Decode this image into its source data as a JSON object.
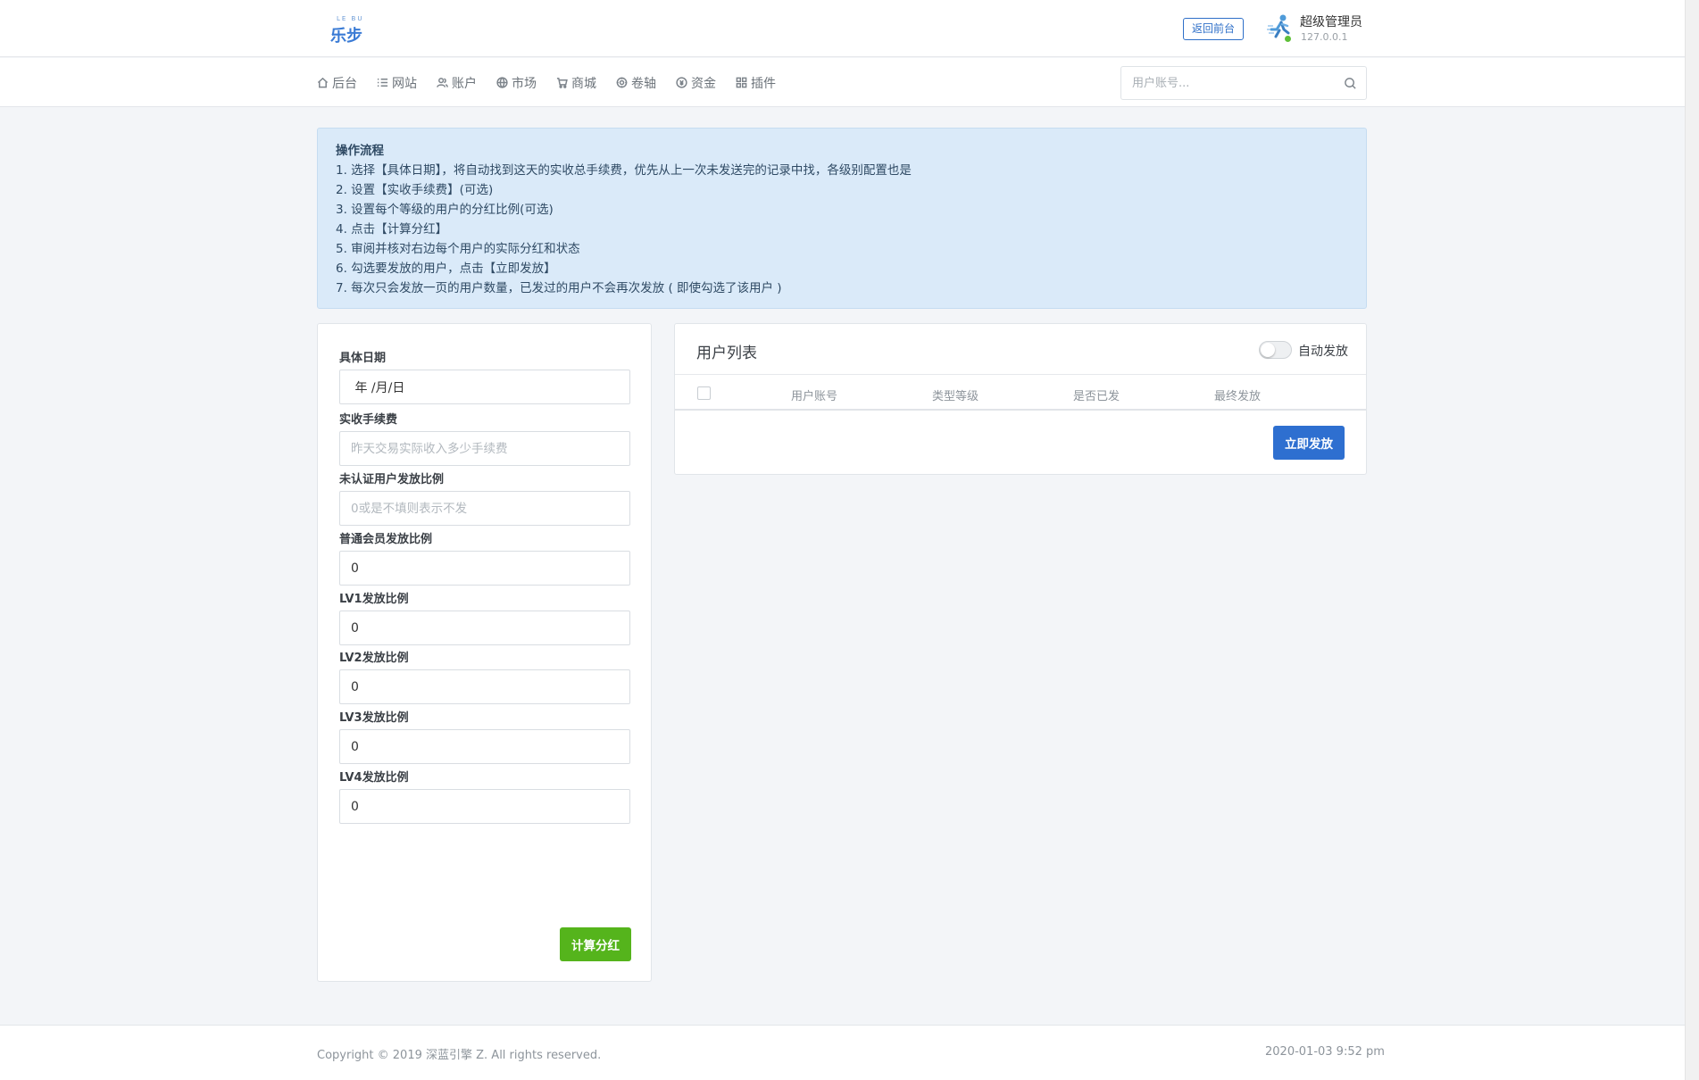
{
  "header": {
    "logo_top": "LE BU",
    "logo_text": "乐步",
    "back_label": "返回前台",
    "user_name": "超级管理员",
    "user_ip": "127.0.0.1"
  },
  "nav": {
    "items": [
      {
        "label": "后台",
        "icon": "home-icon"
      },
      {
        "label": "网站",
        "icon": "list-icon"
      },
      {
        "label": "账户",
        "icon": "users-icon"
      },
      {
        "label": "市场",
        "icon": "globe-icon"
      },
      {
        "label": "商城",
        "icon": "cart-icon"
      },
      {
        "label": "卷轴",
        "icon": "gear-icon"
      },
      {
        "label": "资金",
        "icon": "coin-icon"
      },
      {
        "label": "插件",
        "icon": "grid-icon"
      }
    ],
    "search_placeholder": "用户账号..."
  },
  "alert": {
    "title": "操作流程",
    "lines": [
      "1. 选择【具体日期】，将自动找到这天的实收总手续费，优先从上一次未发送完的记录中找，各级别配置也是",
      "2. 设置【实收手续费】(可选)",
      "3. 设置每个等级的用户的分红比例(可选)",
      "4. 点击【计算分红】",
      "5. 审阅并核对右边每个用户的实际分红和状态",
      "6. 勾选要发放的用户，点击【立即发放】",
      "7. 每次只会发放一页的用户数量，已发过的用户不会再次发放 ( 即使勾选了该用户 )"
    ]
  },
  "form": {
    "fields": [
      {
        "label": "具体日期",
        "value": " 年 /月/日",
        "placeholder": ""
      },
      {
        "label": "实收手续费",
        "value": "",
        "placeholder": "昨天交易实际收入多少手续费"
      },
      {
        "label": "未认证用户发放比例",
        "value": "",
        "placeholder": "0或是不填则表示不发"
      },
      {
        "label": "普通会员发放比例",
        "value": "0",
        "placeholder": ""
      },
      {
        "label": "LV1发放比例",
        "value": "0",
        "placeholder": ""
      },
      {
        "label": "LV2发放比例",
        "value": "0",
        "placeholder": ""
      },
      {
        "label": "LV3发放比例",
        "value": "0",
        "placeholder": ""
      },
      {
        "label": "LV4发放比例",
        "value": "0",
        "placeholder": ""
      }
    ],
    "calc_button": "计算分红"
  },
  "user_list": {
    "title": "用户列表",
    "toggle_label": "自动发放",
    "toggle_on": false,
    "columns": [
      "用户账号",
      "类型等级",
      "是否已发",
      "最终发放"
    ],
    "send_button": "立即发放"
  },
  "footer": {
    "copyright": "Copyright © 2019 深蓝引擎 Z. All rights reserved.",
    "time": "2020-01-03 9:52 pm"
  },
  "colors": {
    "primary": "#2e6fd0",
    "success": "#55b41c",
    "alert_bg": "#daeaf9",
    "online": "#5fbf39"
  }
}
